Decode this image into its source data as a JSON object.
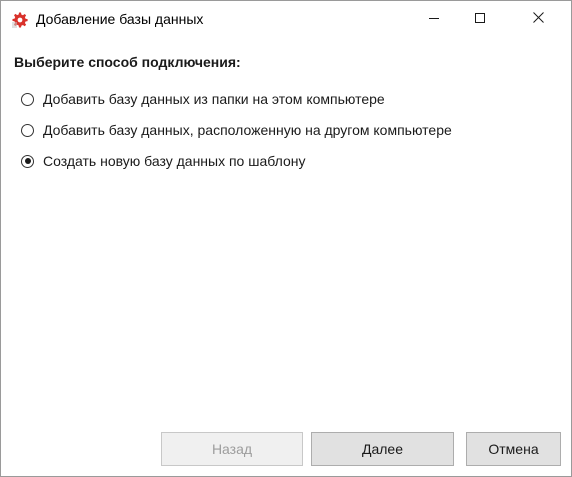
{
  "window": {
    "title": "Добавление базы данных",
    "icon": "gear-icon",
    "controls": {
      "minimize": "minimize-icon",
      "maximize": "maximize-icon",
      "close": "close-icon"
    }
  },
  "main": {
    "heading": "Выберите способ подключения:",
    "options": [
      {
        "label": "Добавить базу данных из папки на этом компьютере",
        "checked": false
      },
      {
        "label": "Добавить базу данных, расположенную на другом компьютере",
        "checked": false
      },
      {
        "label": "Создать новую базу данных по шаблону",
        "checked": true
      }
    ]
  },
  "buttons": {
    "back": {
      "label": "Назад",
      "enabled": false
    },
    "next": {
      "label": "Далее",
      "enabled": true
    },
    "cancel": {
      "label": "Отмена",
      "enabled": true
    }
  },
  "colors": {
    "icon_accent": "#d9322b",
    "disabled_text": "#9d9d9d",
    "button_face": "#e1e1e1"
  }
}
